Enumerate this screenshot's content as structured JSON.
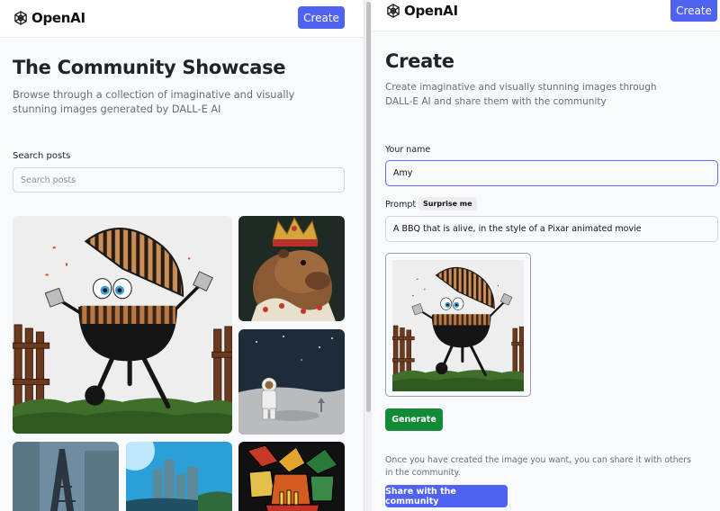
{
  "left_window": {
    "header": {
      "brand": "OpenAI",
      "create_label": "Create"
    },
    "title": "The Community Showcase",
    "description": "Browse through a collection of imaginative and visually stunning images generated by DALL-E AI",
    "search": {
      "label": "Search posts",
      "placeholder": "Search posts",
      "value": ""
    },
    "gallery_images": [
      "bbq-grill",
      "capybara-king",
      "astronaut-moon",
      "eiffel-tower-painting",
      "castle-river",
      "stained-glass-fries"
    ]
  },
  "right_window": {
    "header": {
      "brand": "OpenAI",
      "create_label": "Create"
    },
    "title": "Create",
    "description": "Create imaginative and visually stunning images through DALL-E AI and share them with the community",
    "name_field": {
      "label": "Your name",
      "value": "Amy"
    },
    "prompt_field": {
      "label": "Prompt",
      "surprise_label": "Surprise me",
      "value": "A BBQ that is alive, in the style of a Pixar animated movie"
    },
    "generate_label": "Generate",
    "share_note": "Once you have created the image you want, you can share it with others in the community.",
    "share_label": "Share with the community"
  },
  "colors": {
    "primary": "#4f63f0",
    "generate": "#138a36",
    "background": "#f9fafe",
    "title": "#222328",
    "muted": "#666e75"
  }
}
